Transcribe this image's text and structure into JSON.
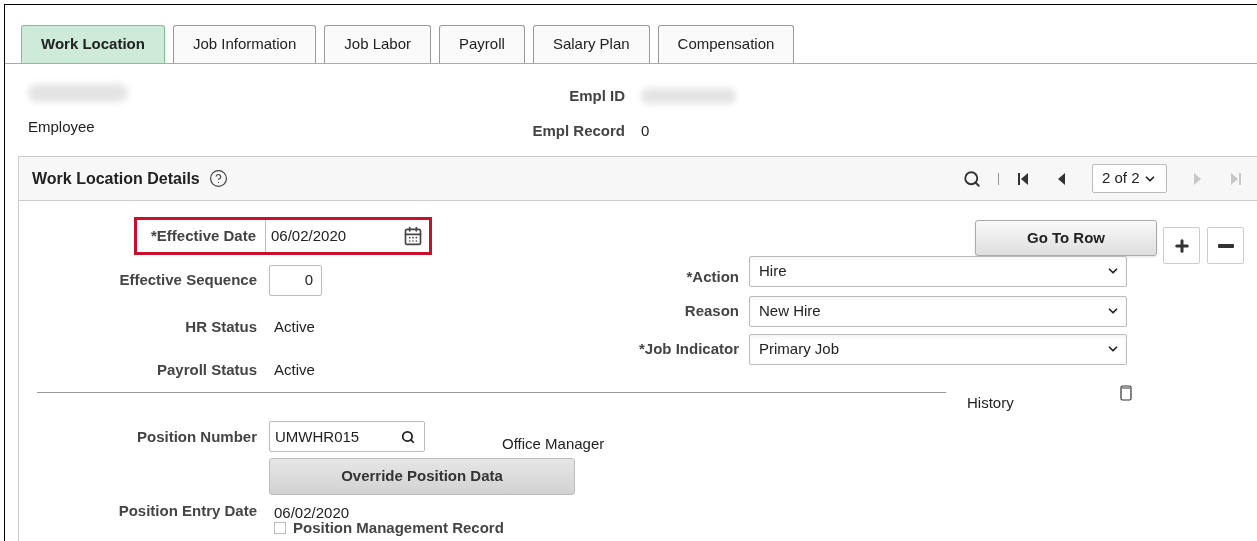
{
  "tabs": [
    {
      "label": "Work Location",
      "selected": true
    },
    {
      "label": "Job Information",
      "selected": false
    },
    {
      "label": "Job Labor",
      "selected": false
    },
    {
      "label": "Payroll",
      "selected": false
    },
    {
      "label": "Salary Plan",
      "selected": false
    },
    {
      "label": "Compensation",
      "selected": false
    }
  ],
  "header": {
    "employee_label": "Employee",
    "empl_id_label": "Empl ID",
    "empl_record_label": "Empl Record",
    "empl_record_value": "0"
  },
  "panel": {
    "title": "Work Location Details",
    "pager": "2 of 2",
    "nav": [
      {
        "kind": "first",
        "disabled": false
      },
      {
        "kind": "prev",
        "disabled": false
      },
      {
        "kind": "next",
        "disabled": true
      },
      {
        "kind": "last",
        "disabled": true
      }
    ],
    "go_to_row": "Go To Row"
  },
  "left": {
    "effective_date_label": "*Effective Date",
    "effective_date": "06/02/2020",
    "effective_sequence_label": "Effective Sequence",
    "effective_sequence": "0",
    "hr_status_label": "HR Status",
    "hr_status": "Active",
    "payroll_status_label": "Payroll Status",
    "payroll_status": "Active",
    "position_number_label": "Position Number",
    "position_number": "UMWHR015",
    "position_title": "Office Manager",
    "override_button": "Override Position Data",
    "position_entry_date_label": "Position Entry Date",
    "position_entry_date": "06/02/2020",
    "position_management": {
      "label": "Position Management Record",
      "checked": false
    }
  },
  "right": {
    "selects": [
      {
        "label": "*Action",
        "value": "Hire"
      },
      {
        "label": "Reason",
        "value": "New Hire"
      },
      {
        "label": "*Job Indicator",
        "value": "Primary Job"
      }
    ],
    "history_label": "History"
  }
}
